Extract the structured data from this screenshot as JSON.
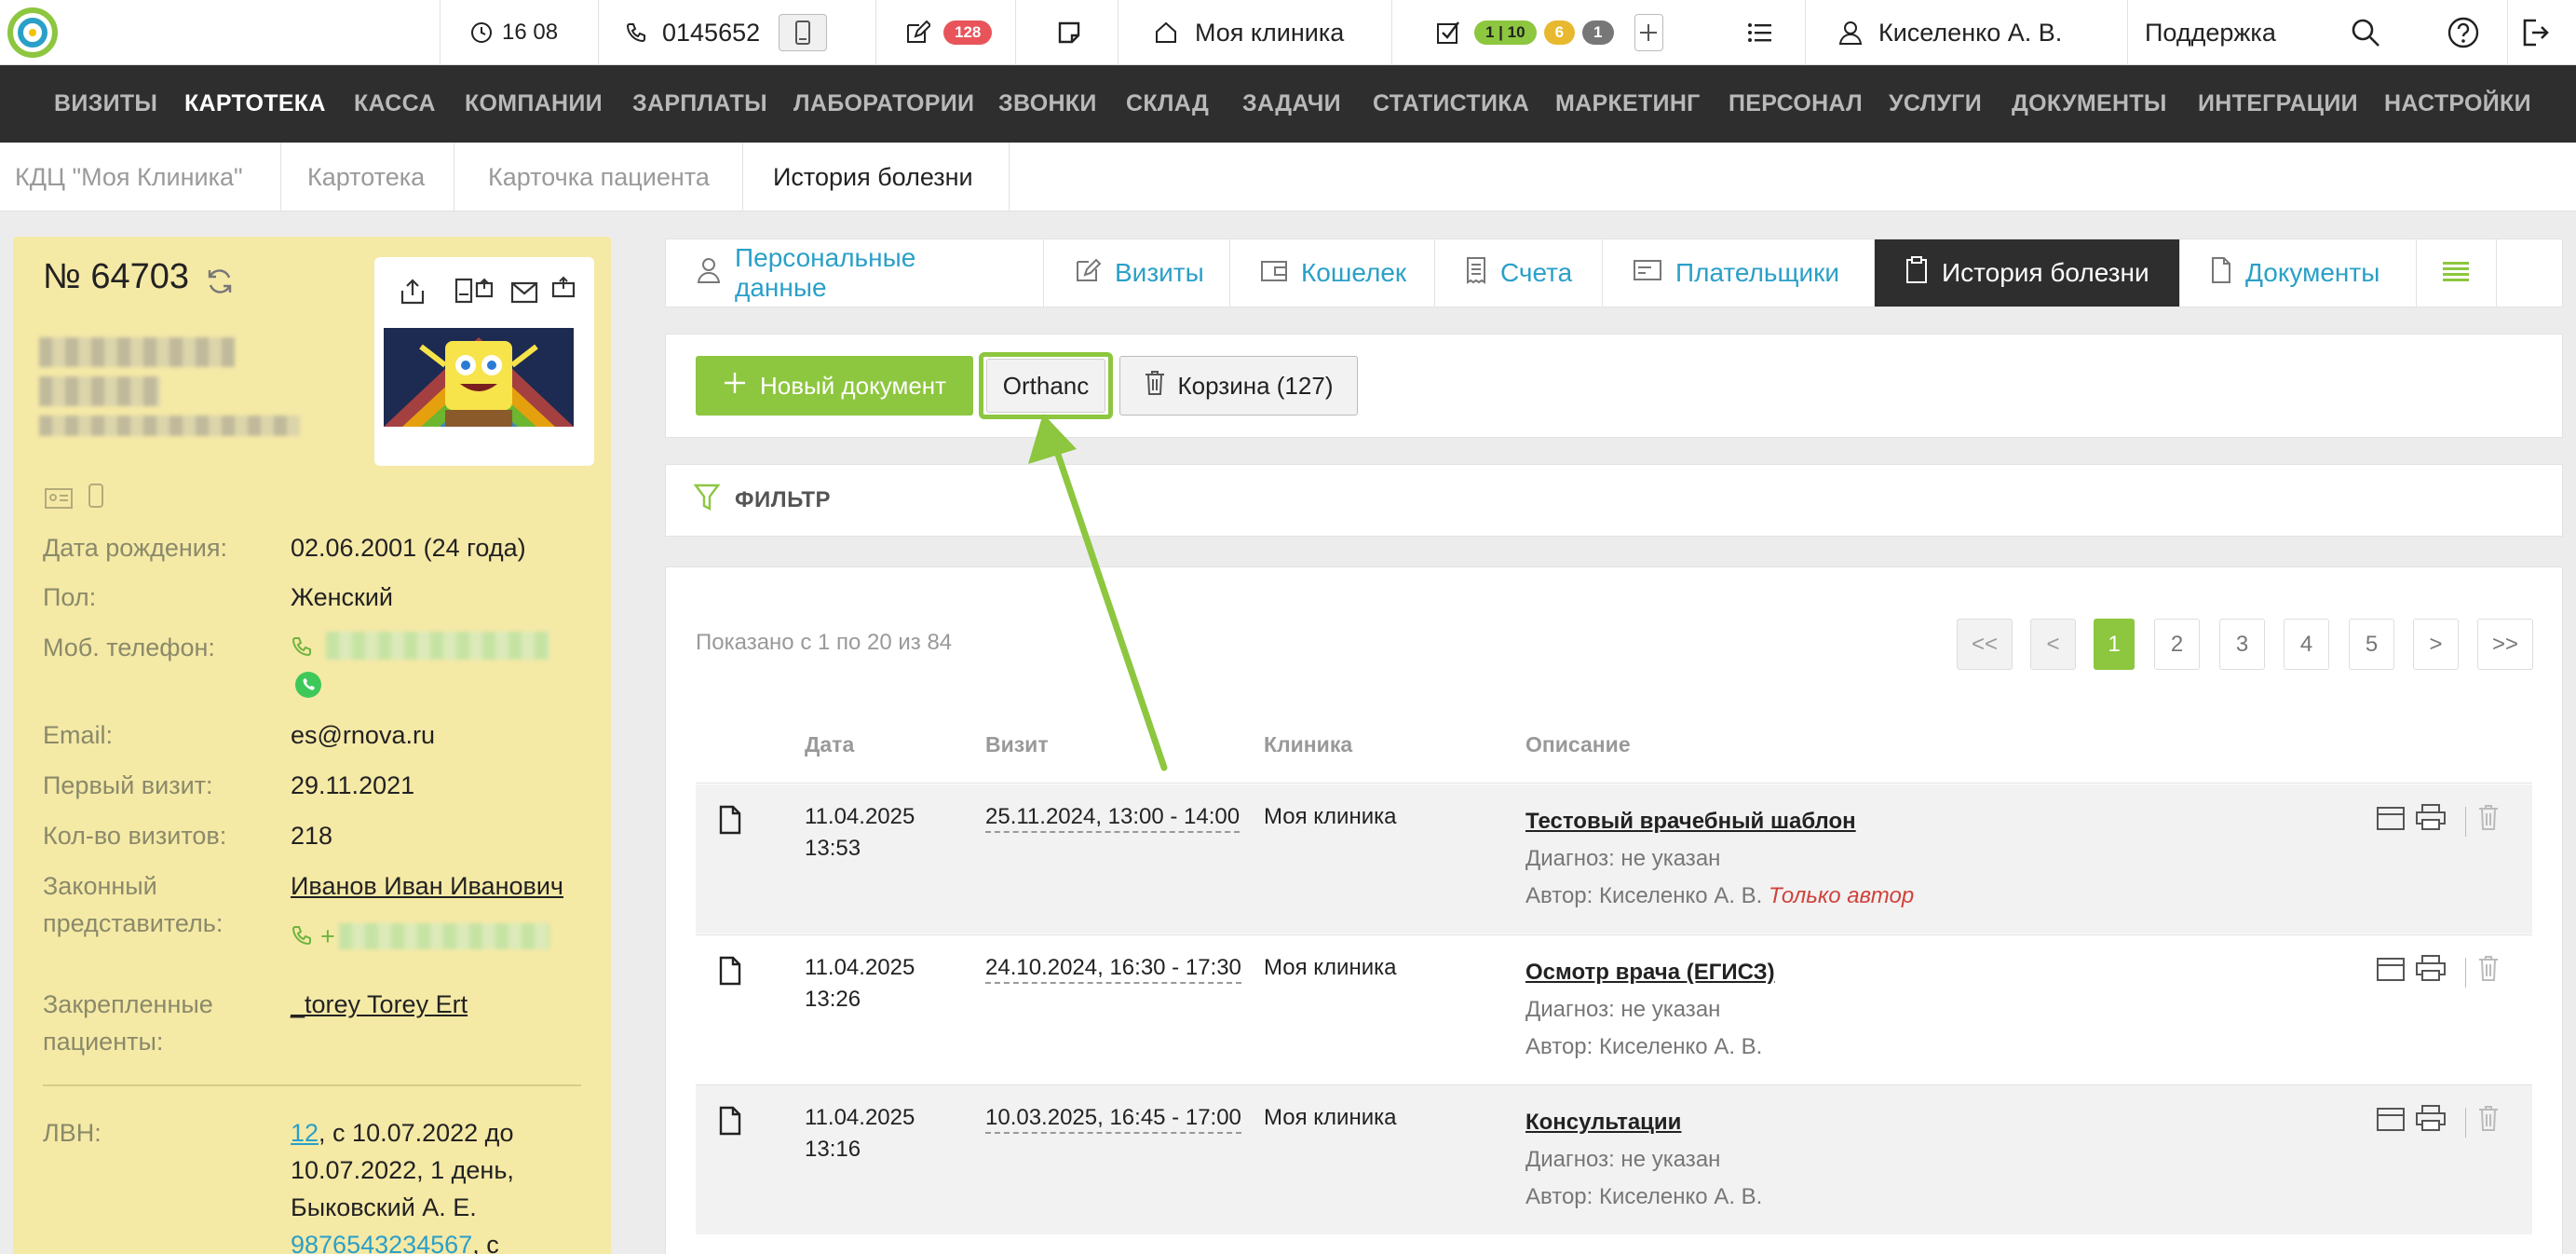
{
  "topbar": {
    "time": "16 08",
    "phone": "0145652",
    "notes_badge": "128",
    "tasks_badge_green": "1 | 10",
    "tasks_badge_yellow": "6",
    "tasks_badge_gray": "1",
    "clinic": "Моя клиника",
    "user": "Киселенко А. В.",
    "support": "Поддержка"
  },
  "nav": [
    "ВИЗИТЫ",
    "КАРТОТЕКА",
    "КАССА",
    "КОМПАНИИ",
    "ЗАРПЛАТЫ",
    "ЛАБОРАТОРИИ",
    "ЗВОНКИ",
    "СКЛАД",
    "ЗАДАЧИ",
    "СТАТИСТИКА",
    "МАРКЕТИНГ",
    "ПЕРСОНАЛ",
    "УСЛУГИ",
    "ДОКУМЕНТЫ",
    "ИНТЕГРАЦИИ",
    "НАСТРОЙКИ"
  ],
  "breadcrumb": [
    "КДЦ \"Моя Клиника\"",
    "Картотека",
    "Карточка пациента",
    "История болезни"
  ],
  "patient": {
    "number": "№ 64703",
    "birth_label": "Дата рождения:",
    "birth_value": "02.06.2001 (24 года)",
    "sex_label": "Пол:",
    "sex_value": "Женский",
    "phone_label": "Моб. телефон:",
    "email_label": "Email:",
    "email_value": "es@rnova.ru",
    "first_visit_label": "Первый визит:",
    "first_visit_value": "29.11.2021",
    "visits_count_label": "Кол-во визитов:",
    "visits_count_value": "218",
    "rep_label_1": "Законный",
    "rep_label_2": "представитель:",
    "rep_value": "Иванов Иван Иванович",
    "rep_phone_prefix": "+",
    "attached_label_1": "Закрепленные",
    "attached_label_2": "пациенты:",
    "attached_value": "_torey Torey Ert",
    "lvn_label": "ЛВН:",
    "lvn_link1": "12",
    "lvn_text1": ", с 10.07.2022 до",
    "lvn_text2": "10.07.2022, 1 день,",
    "lvn_text3": "Быковский А. Е.",
    "lvn_link2": "9876543234567",
    "lvn_text4": ", с"
  },
  "tabs": [
    "Персональные данные",
    "Визиты",
    "Кошелек",
    "Счета",
    "Плательщики",
    "История болезни",
    "Документы"
  ],
  "actions": {
    "new_doc": "Новый документ",
    "orthanc": "Orthanc",
    "trash": "Корзина (127)"
  },
  "filter_label": "ФИЛЬТР",
  "shown_text": "Показано с 1 по 20 из 84",
  "pagination": [
    "<<",
    "<",
    "1",
    "2",
    "3",
    "4",
    "5",
    ">",
    ">>"
  ],
  "table": {
    "headers": [
      "Дата",
      "Визит",
      "Клиника",
      "Описание"
    ],
    "rows": [
      {
        "date1": "11.04.2025",
        "date2": "13:53",
        "visit": "25.11.2024, 13:00 - 14:00",
        "clinic": "Моя клиника",
        "title": "Тестовый врачебный шаблон",
        "diag": "Диагноз: не указан",
        "author": "Автор: Киселенко А. В.",
        "note": "Только автор"
      },
      {
        "date1": "11.04.2025",
        "date2": "13:26",
        "visit": "24.10.2024, 16:30 - 17:30",
        "clinic": "Моя клиника",
        "title": "Осмотр врача (ЕГИСЗ)",
        "diag": "Диагноз: не указан",
        "author": "Автор: Киселенко А. В.",
        "note": ""
      },
      {
        "date1": "11.04.2025",
        "date2": "13:16",
        "visit": "10.03.2025, 16:45 - 17:00",
        "clinic": "Моя клиника",
        "title": "Консультации",
        "diag": "Диагноз: не указан",
        "author": "Автор: Киселенко А. В.",
        "note": ""
      }
    ]
  },
  "colors": {
    "accent": "#8dc63f",
    "link": "#2aa0c8",
    "dark": "#2e2e2e",
    "badge_red": "#e8545a",
    "badge_yellow": "#e8b92e",
    "panel_yellow": "#f5e9a6"
  }
}
